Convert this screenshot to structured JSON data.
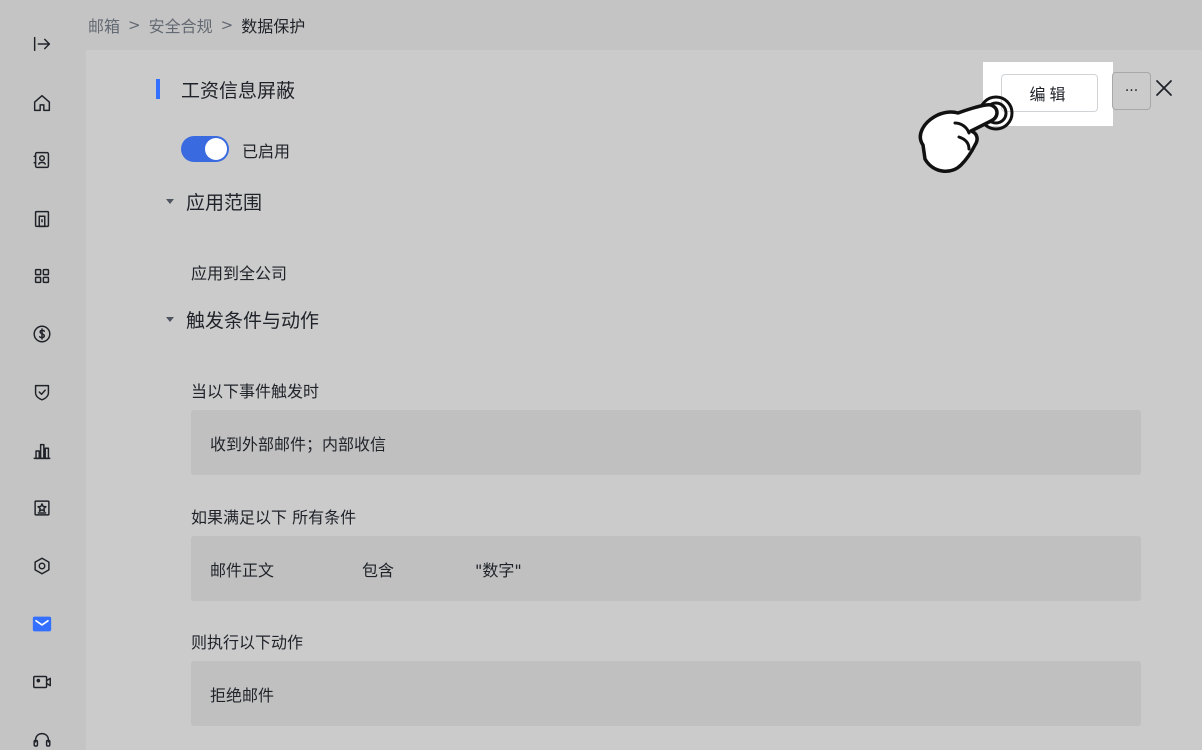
{
  "breadcrumb": [
    "邮箱",
    "安全合规",
    "数据保护"
  ],
  "breadcrumb_separator": ">",
  "sidebar": {
    "icons": [
      "expand-icon",
      "home-icon",
      "contacts-icon",
      "building-icon",
      "apps-icon",
      "billing-icon",
      "security-icon",
      "analytics-icon",
      "award-icon",
      "settings-icon",
      "mail-icon",
      "video-icon",
      "support-icon"
    ],
    "active": "mail-icon",
    "accent_color": "#3370ff"
  },
  "rule": {
    "title": "工资信息屏蔽",
    "enabled": true,
    "status_label": "已启用"
  },
  "scope": {
    "heading": "应用范围",
    "value": "应用到全公司"
  },
  "trigger": {
    "heading": "触发条件与动作",
    "event_label": "当以下事件触发时",
    "event_value": "收到外部邮件；内部收信",
    "condition_label": "如果满足以下 所有条件",
    "condition": {
      "field": "邮件正文",
      "operator": "包含",
      "value": "\"数字\""
    },
    "action_label": "则执行以下动作",
    "action_value": "拒绝邮件"
  },
  "toolbar": {
    "edit_label": "编辑",
    "more_label": "···"
  },
  "cursor": "pointer-hand-icon"
}
